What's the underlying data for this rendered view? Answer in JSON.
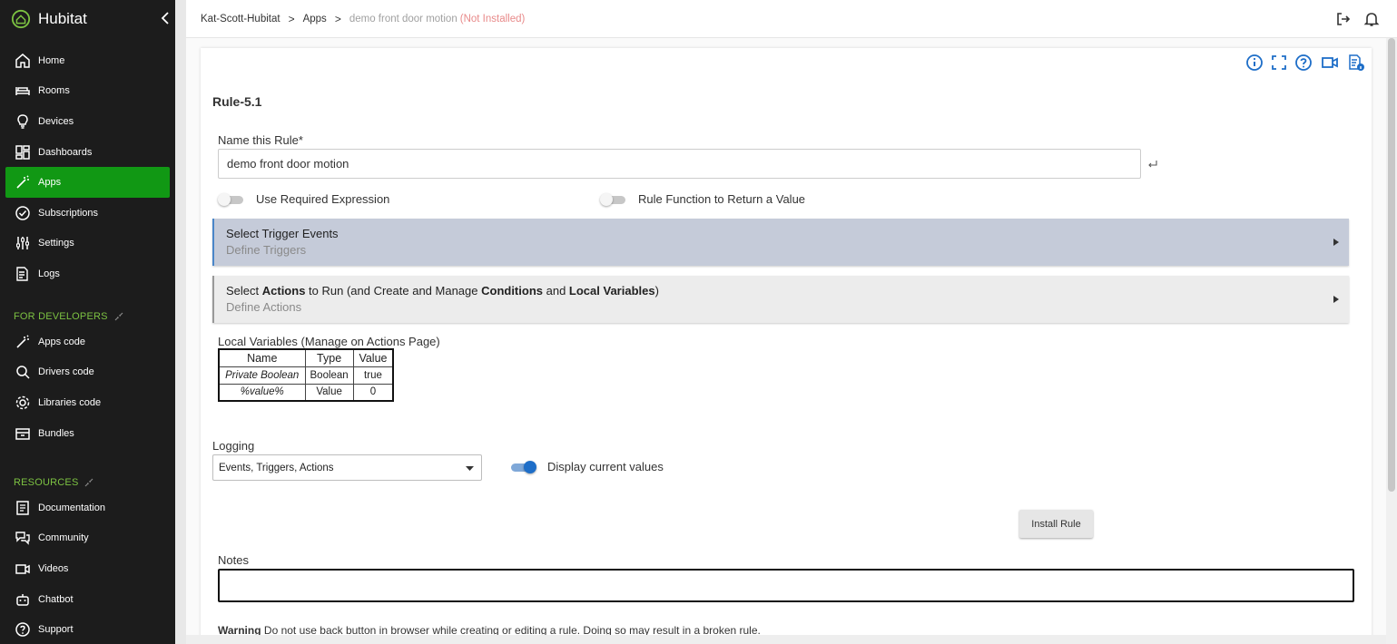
{
  "brand": {
    "name": "Hubitat"
  },
  "sidebar": {
    "main_items": [
      {
        "label": "Home",
        "icon": "home-icon"
      },
      {
        "label": "Rooms",
        "icon": "bed-icon"
      },
      {
        "label": "Devices",
        "icon": "lightbulb-icon"
      },
      {
        "label": "Dashboards",
        "icon": "dashboard-icon"
      },
      {
        "label": "Apps",
        "icon": "magic-wand-icon",
        "active": true
      },
      {
        "label": "Subscriptions",
        "icon": "check-circle-icon"
      },
      {
        "label": "Settings",
        "icon": "sliders-icon"
      },
      {
        "label": "Logs",
        "icon": "log-file-icon"
      }
    ],
    "developers_title": "FOR DEVELOPERS",
    "developer_items": [
      {
        "label": "Apps code"
      },
      {
        "label": "Drivers code"
      },
      {
        "label": "Libraries code"
      },
      {
        "label": "Bundles"
      }
    ],
    "resources_title": "RESOURCES",
    "resource_items": [
      {
        "label": "Documentation"
      },
      {
        "label": "Community"
      },
      {
        "label": "Videos"
      },
      {
        "label": "Chatbot"
      },
      {
        "label": "Support"
      }
    ]
  },
  "breadcrumb": {
    "hub": "Kat-Scott-Hubitat",
    "apps": "Apps",
    "current": "demo front door motion",
    "status": "(Not Installed)"
  },
  "rule": {
    "title": "Rule-5.1",
    "name_label": "Name this Rule*",
    "name_value": "demo front door motion",
    "toggle_required": "Use Required Expression",
    "toggle_function": "Rule Function to Return a Value",
    "triggers_title": "Select Trigger Events",
    "triggers_sub": "Define Triggers",
    "actions_title_pre": "Select ",
    "actions_title_b1": "Actions",
    "actions_title_mid": " to Run (and Create and Manage ",
    "actions_title_b2": "Conditions",
    "actions_title_and": " and ",
    "actions_title_b3": "Local Variables",
    "actions_title_post": ")",
    "actions_sub": "Define Actions",
    "local_vars_title": "Local Variables",
    "local_vars_note": " (Manage on Actions Page)",
    "local_vars": {
      "headers": [
        "Name",
        "Type",
        "Value"
      ],
      "rows": [
        [
          "Private Boolean",
          "Boolean",
          "true"
        ],
        [
          "%value%",
          "Value",
          "0"
        ]
      ]
    },
    "logging_label": "Logging",
    "logging_value": "Events, Triggers, Actions",
    "display_values_label": "Display current values",
    "display_values_on": true,
    "install_button": "Install Rule",
    "notes_label": "Notes",
    "warning_bold": "Warning",
    "warning_text": " Do not use back button in browser while creating or editing a rule. Doing so may result in a broken rule."
  },
  "colors": {
    "sidebar_bg": "#1c1c1c",
    "active_green": "#119814",
    "section_green": "#7cc242",
    "toggle_blue": "#1e6ec8",
    "not_installed": "#e88a8a"
  }
}
